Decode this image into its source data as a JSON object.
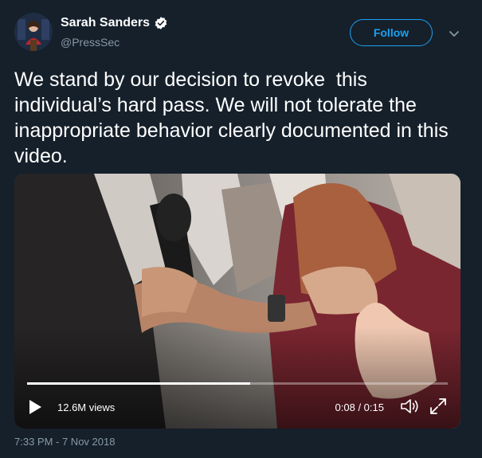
{
  "user": {
    "name": "Sarah Sanders",
    "handle": "@PressSec"
  },
  "header": {
    "follow_label": "Follow"
  },
  "tweet": {
    "text": "We stand by our decision to revoke  this individual’s hard pass. We will not tolerate the inappropriate behavior clearly documented in this video.",
    "timestamp": "7:33 PM - 7 Nov 2018"
  },
  "video": {
    "views": "12.6M views",
    "time": "0:08 / 0:15",
    "progress": 0.53
  },
  "colors": {
    "background": "#15202b",
    "accent": "#1da1f2",
    "secondary_text": "#8899a6"
  },
  "icons": {
    "verified": "verified-badge-icon",
    "chevron": "chevron-down-icon",
    "play": "play-icon",
    "volume": "volume-icon",
    "fullscreen": "fullscreen-icon"
  }
}
